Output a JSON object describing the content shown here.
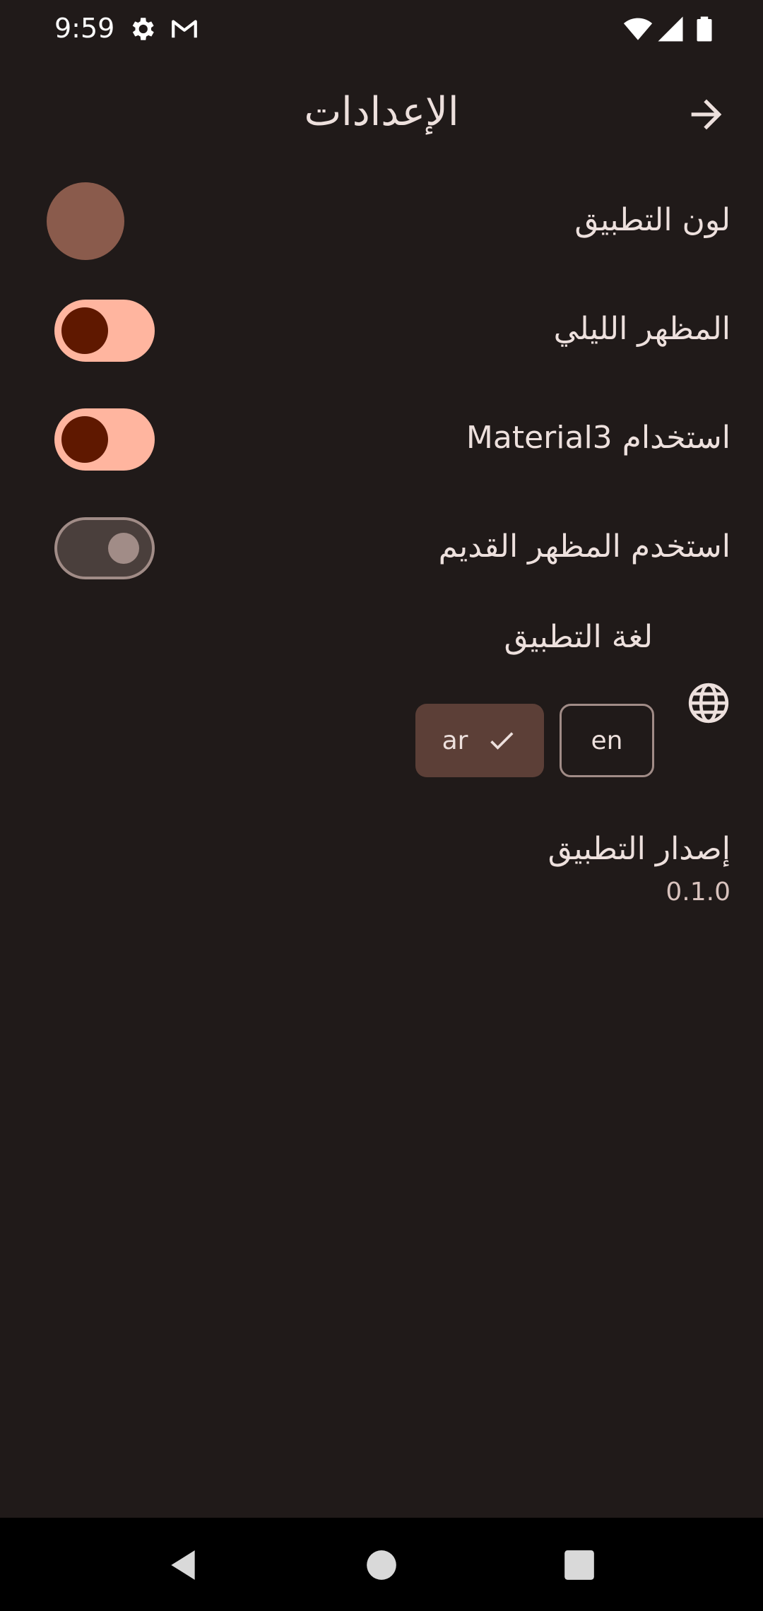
{
  "status_bar": {
    "time": "9:59",
    "icons": [
      "settings-icon",
      "gmail-icon",
      "wifi-icon",
      "signal-icon",
      "battery-icon"
    ]
  },
  "header": {
    "title": "الإعدادات",
    "back_icon": "arrow-forward-icon"
  },
  "settings": {
    "app_color": {
      "label": "لون التطبيق",
      "color": "#8a5b4c"
    },
    "dark_mode": {
      "label": "المظهر الليلي",
      "enabled": true
    },
    "material3": {
      "label": "استخدام Material3",
      "enabled": true
    },
    "old_look": {
      "label": "استخدم المظهر القديم",
      "enabled": false
    },
    "language": {
      "label": "لغة التطبيق",
      "icon": "globe-icon",
      "options": [
        {
          "label": "ar",
          "selected": true
        },
        {
          "label": "en",
          "selected": false
        }
      ]
    },
    "version": {
      "label": "إصدار التطبيق",
      "value": "0.1.0"
    }
  },
  "nav_bar": {
    "icons": [
      "back-triangle-icon",
      "home-circle-icon",
      "recents-square-icon"
    ]
  },
  "colors": {
    "background": "#201a19",
    "switch_on_track": "#ffb59f",
    "switch_on_thumb": "#5f1800",
    "chip_selected": "#5c3f37",
    "outline": "#a18c87"
  }
}
